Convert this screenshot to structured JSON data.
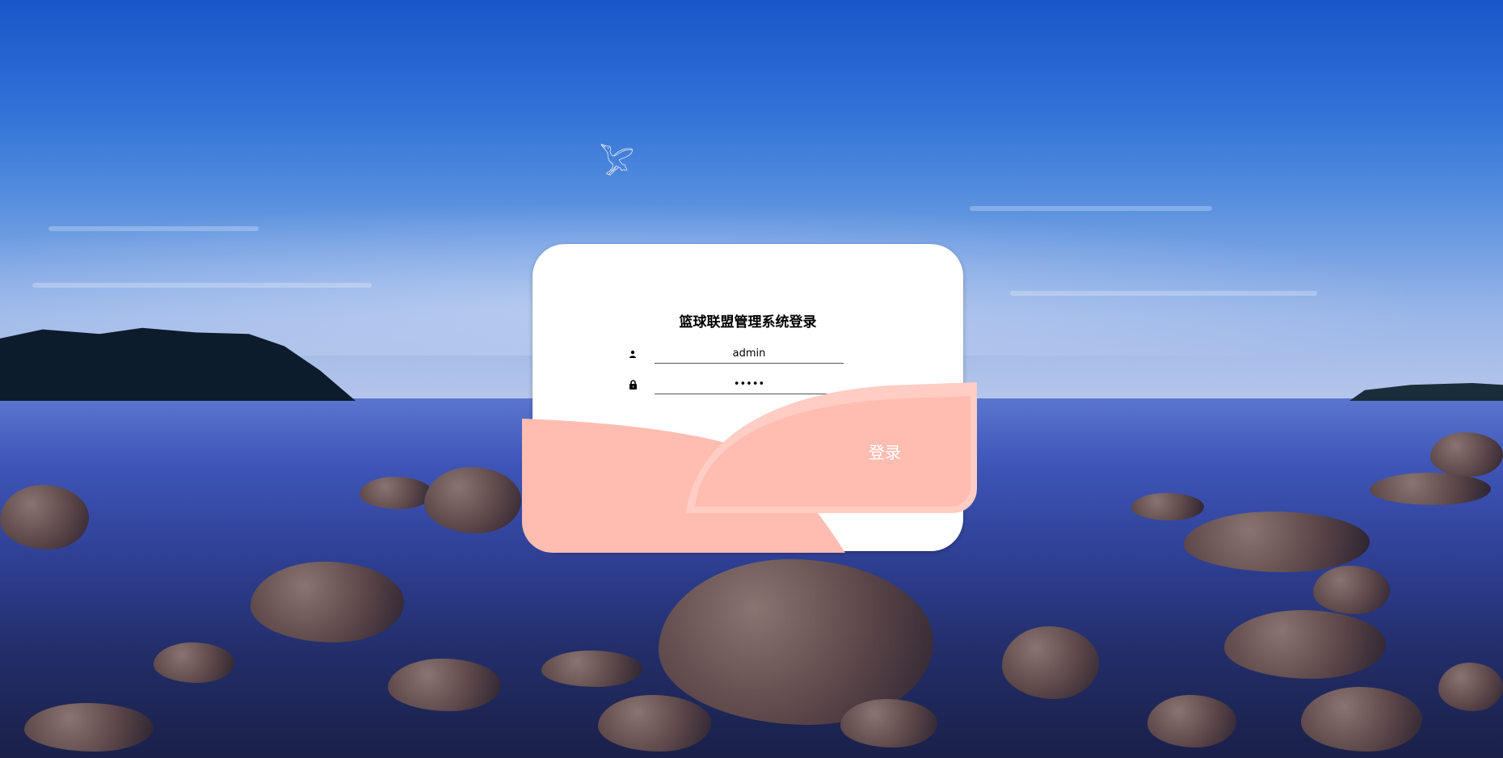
{
  "page": {
    "title": "篮球联盟管理系统登录"
  },
  "form": {
    "username_value": "admin",
    "password_value": "•••••",
    "username_icon": "user-icon",
    "password_icon": "lock-icon"
  },
  "actions": {
    "login_label": "登录"
  },
  "colors": {
    "card_bg": "#ffffff",
    "accent_pink": "#ffbdb2",
    "accent_pink_light": "#ffcdc3",
    "button_text": "#ffffff"
  }
}
